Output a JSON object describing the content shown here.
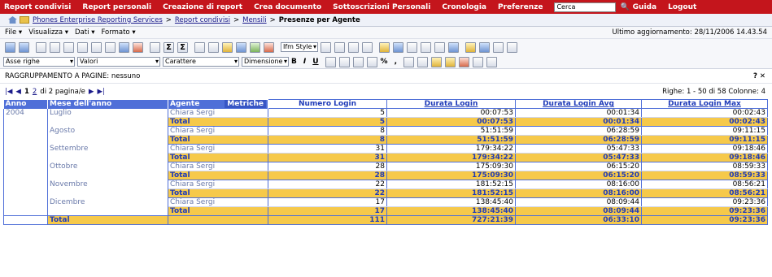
{
  "topnav": {
    "items": [
      "Report condivisi",
      "Report personali",
      "Creazione di report",
      "Crea documento",
      "Sottoscrizioni Personali",
      "Cronologia",
      "Preferenze"
    ],
    "search_value": "Cerca",
    "help": "Guida",
    "logout": "Logout"
  },
  "breadcrumb": {
    "root": "Phones Enterprise Reporting Services",
    "folder1": "Report condivisi",
    "folder2": "Mensili",
    "current": "Presenze per Agente",
    "sep": ">"
  },
  "menubar": {
    "items": [
      "File ▾",
      "Visualizza ▾",
      "Dati ▾",
      "Formato ▾"
    ],
    "last_update": "Ultimo aggiornamento: 28/11/2006 14.43.54"
  },
  "toolbar": {
    "style_dropdown": "Ifm Style",
    "dd_rows": "Asse righe",
    "dd_values": "Valori",
    "dd_font": "Carattere",
    "dd_size": "Dimensione",
    "bold": "B",
    "italic": "I",
    "underline": "U",
    "percent": "%",
    "comma": ","
  },
  "grouping": {
    "label": "RAGGRUPPAMENTO A PAGINE: nessuno",
    "help": "? ✕"
  },
  "pager": {
    "first": "|◀",
    "prev": "◀",
    "page1": "1",
    "page2": "2",
    "of": "di 2 pagina/e",
    "next": "▶",
    "last": "▶|",
    "rows_info": "Righe: 1 - 50 di 58   Colonne: 4"
  },
  "table": {
    "headers": {
      "year": "Anno",
      "month": "Mese dell'anno",
      "agent": "Agente",
      "metrics": "Metriche",
      "m1": "Numero Login",
      "m2": "Durata Login",
      "m3": "Durata Login Avg",
      "m4": "Durata Login Max"
    },
    "year": "2004",
    "total_label": "Total",
    "months": [
      {
        "name": "Luglio",
        "agent": "Chiara Sergi",
        "vals": [
          "5",
          "00:07:53",
          "00:01:34",
          "00:02:43"
        ],
        "tot": [
          "5",
          "00:07:53",
          "00:01:34",
          "00:02:43"
        ]
      },
      {
        "name": "Agosto",
        "agent": "Chiara Sergi",
        "vals": [
          "8",
          "51:51:59",
          "06:28:59",
          "09:11:15"
        ],
        "tot": [
          "8",
          "51:51:59",
          "06:28:59",
          "09:11:15"
        ]
      },
      {
        "name": "Settembre",
        "agent": "Chiara Sergi",
        "vals": [
          "31",
          "179:34:22",
          "05:47:33",
          "09:18:46"
        ],
        "tot": [
          "31",
          "179:34:22",
          "05:47:33",
          "09:18:46"
        ]
      },
      {
        "name": "Ottobre",
        "agent": "Chiara Sergi",
        "vals": [
          "28",
          "175:09:30",
          "06:15:20",
          "08:59:33"
        ],
        "tot": [
          "28",
          "175:09:30",
          "06:15:20",
          "08:59:33"
        ]
      },
      {
        "name": "Novembre",
        "agent": "Chiara Sergi",
        "vals": [
          "22",
          "181:52:15",
          "08:16:00",
          "08:56:21"
        ],
        "tot": [
          "22",
          "181:52:15",
          "08:16:00",
          "08:56:21"
        ]
      },
      {
        "name": "Dicembre",
        "agent": "Chiara Sergi",
        "vals": [
          "17",
          "138:45:40",
          "08:09:44",
          "09:23:36"
        ],
        "tot": [
          "17",
          "138:45:40",
          "08:09:44",
          "09:23:36"
        ]
      }
    ],
    "grand_total": [
      "111",
      "727:21:39",
      "06:33:10",
      "09:23:36"
    ]
  }
}
